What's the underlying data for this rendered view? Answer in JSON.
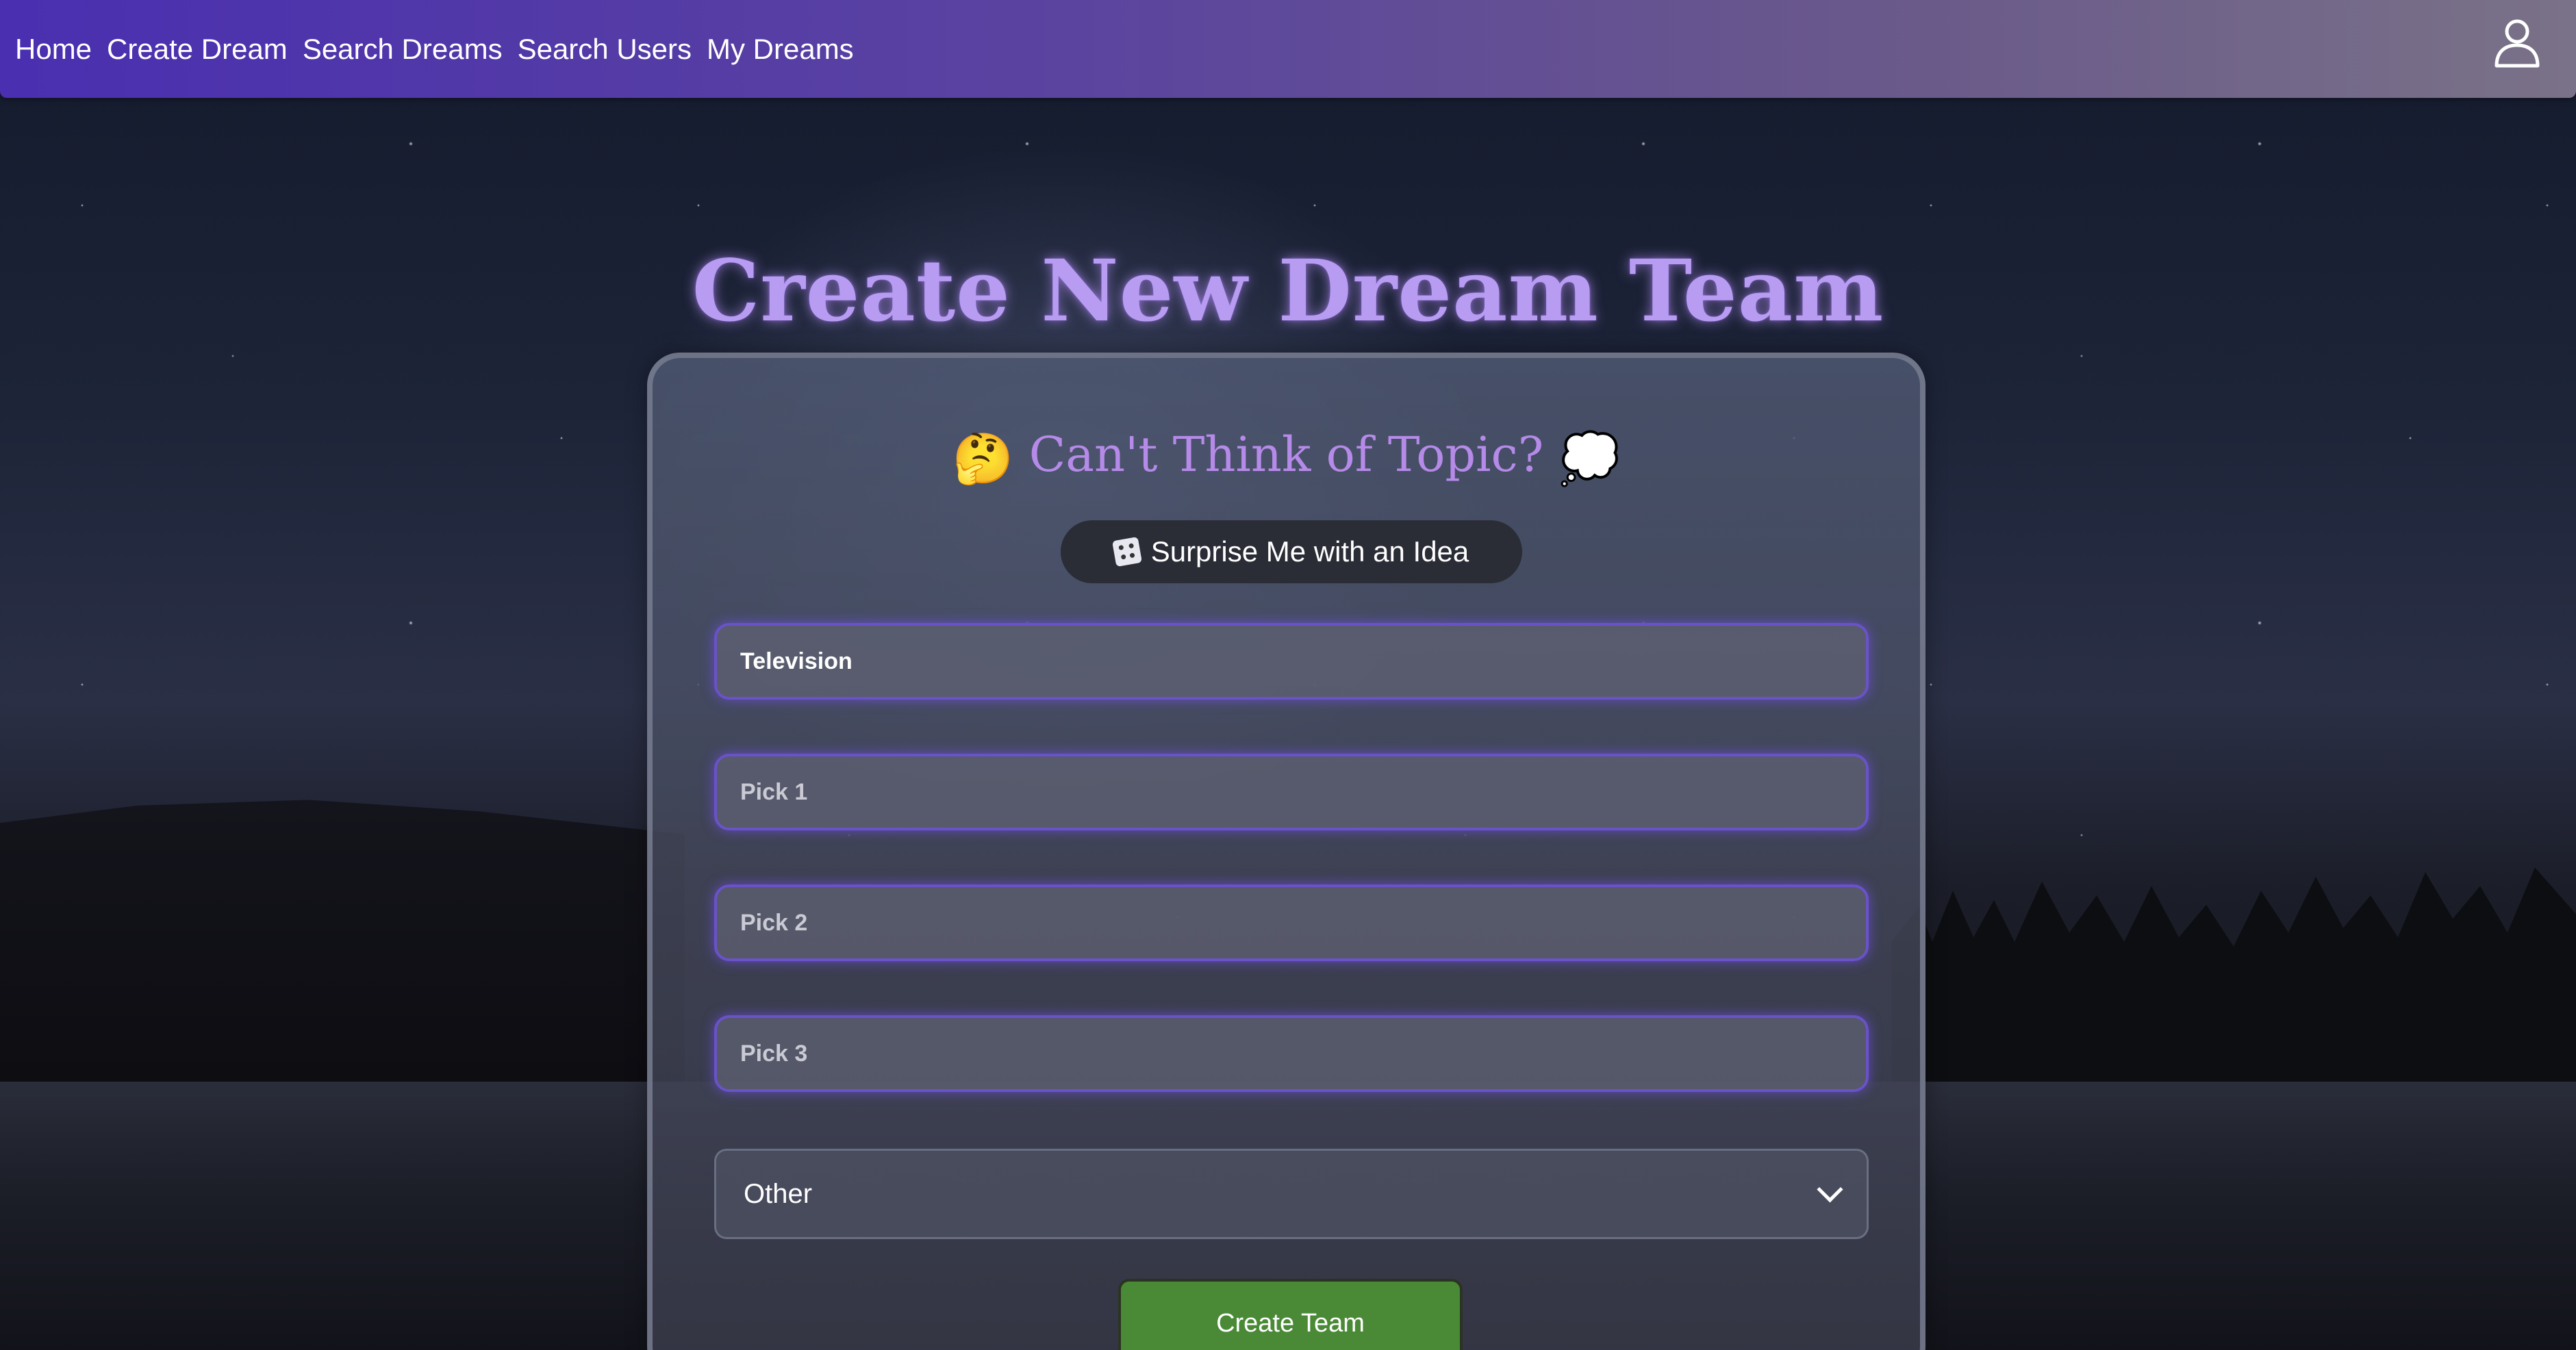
{
  "nav": {
    "links": [
      "Home",
      "Create Dream",
      "Search Dreams",
      "Search Users",
      "My Dreams"
    ]
  },
  "header": {
    "title": "Create New Dream Team"
  },
  "form": {
    "topic_heading": "Can't Think of Topic?",
    "topic_heading_emoji_left": "🤔",
    "topic_heading_emoji_right": "💭",
    "surprise_label": "Surprise Me with an Idea",
    "topic_value": "Television",
    "pick1_placeholder": "Pick 1",
    "pick2_placeholder": "Pick 2",
    "pick3_placeholder": "Pick 3",
    "category_selected": "Other",
    "submit_label": "Create Team"
  },
  "icons": {
    "user": "user-icon",
    "dice": "dice-icon",
    "chevron": "chevron-down-icon"
  },
  "colors": {
    "title": "#b79cf2",
    "accent": "#6a52c8",
    "submit": "#4a8a36"
  }
}
